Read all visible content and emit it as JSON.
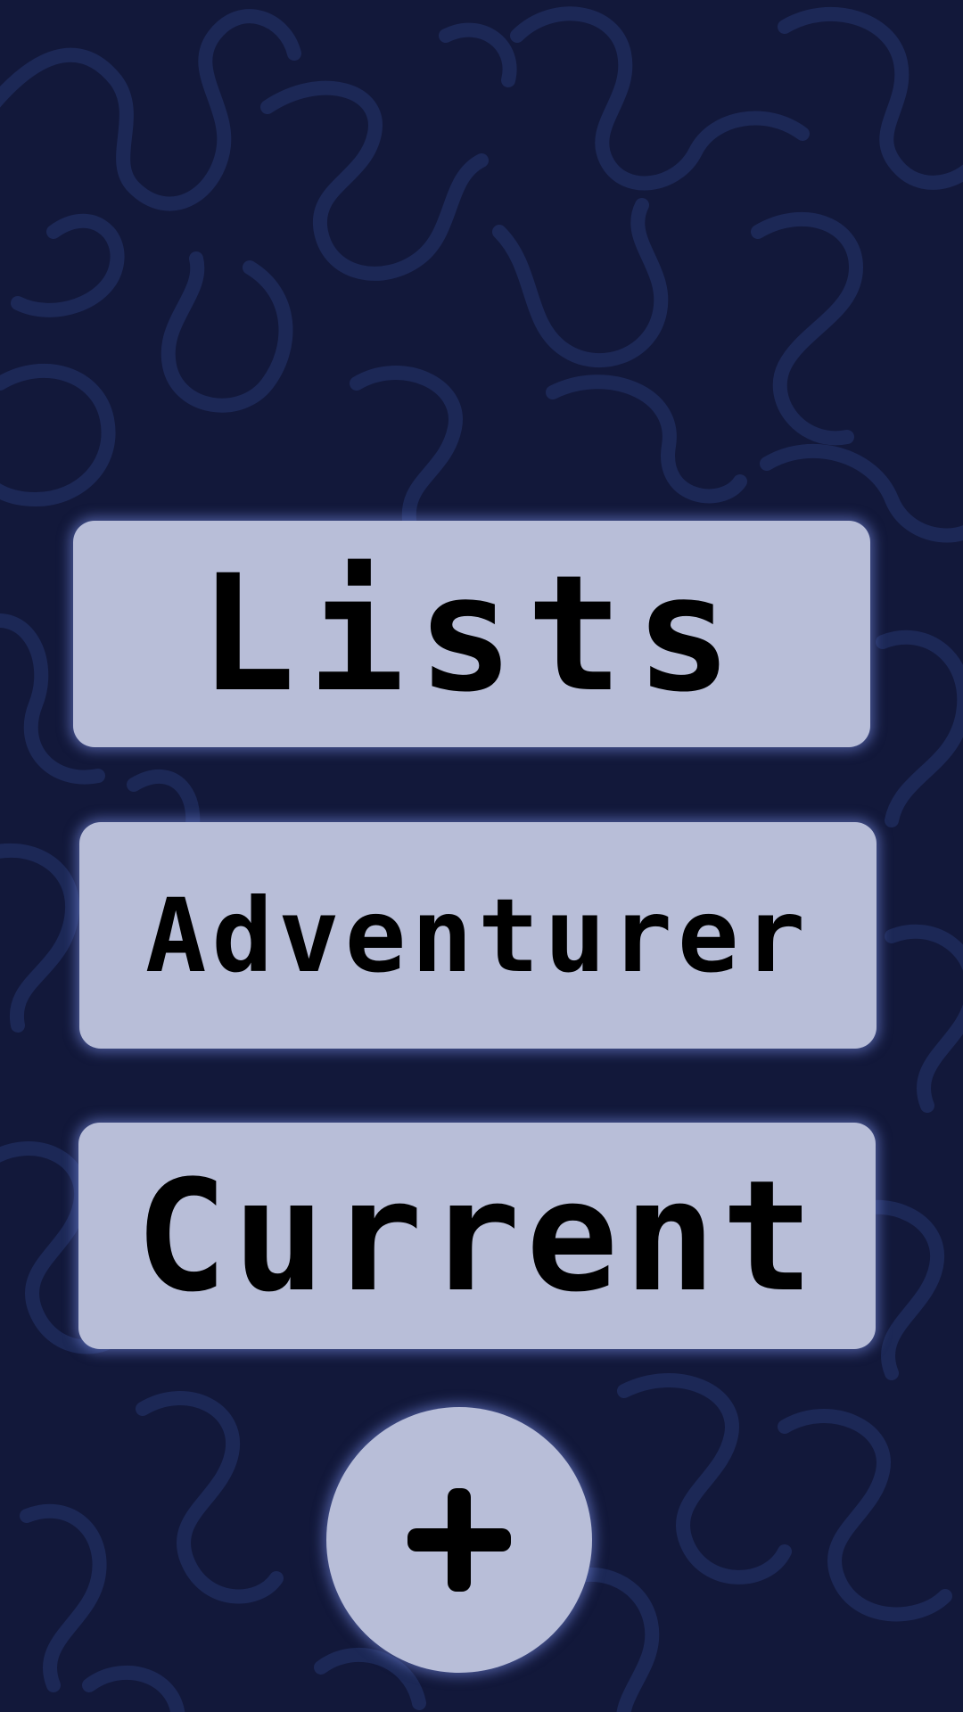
{
  "colors": {
    "background": "#12183a",
    "squiggle": "#1e2a5a",
    "button_fill": "#b8bed8",
    "button_glow": "#7890e6",
    "text": "#000000"
  },
  "menu": {
    "lists_label": "Lists",
    "adventurer_label": "Adventurer",
    "current_label": "Current"
  },
  "add_button": {
    "icon": "plus-icon"
  }
}
